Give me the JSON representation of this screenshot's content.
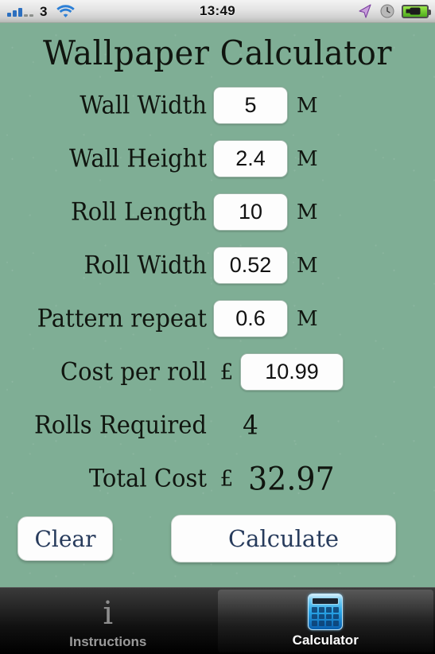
{
  "status_bar": {
    "signal_icon": "signal-bars-icon",
    "carrier": "3",
    "wifi_icon": "wifi-icon",
    "time": "13:49",
    "location_icon": "location-arrow-icon",
    "alarm_icon": "alarm-clock-icon",
    "battery_icon": "battery-charging-icon"
  },
  "app": {
    "title": "Wallpaper Calculator",
    "background_color": "#7fae95"
  },
  "form": {
    "rows": [
      {
        "label": "Wall Width",
        "value": "5",
        "unit": "M",
        "currency": ""
      },
      {
        "label": "Wall Height",
        "value": "2.4",
        "unit": "M",
        "currency": ""
      },
      {
        "label": "Roll Length",
        "value": "10",
        "unit": "M",
        "currency": ""
      },
      {
        "label": "Roll Width",
        "value": "0.52",
        "unit": "M",
        "currency": ""
      },
      {
        "label": "Pattern repeat",
        "value": "0.6",
        "unit": "M",
        "currency": ""
      },
      {
        "label": "Cost per roll",
        "value": "10.99",
        "unit": "",
        "currency": "£"
      }
    ]
  },
  "results": {
    "rolls": {
      "label": "Rolls Required",
      "value": "4",
      "currency": ""
    },
    "total": {
      "label": "Total Cost",
      "value": "32.97",
      "currency": "£"
    }
  },
  "buttons": {
    "clear": "Clear",
    "calculate": "Calculate",
    "text_color": "#273b5c"
  },
  "tab_bar": {
    "tabs": [
      {
        "label": "Instructions",
        "icon": "info-i-icon",
        "active": false
      },
      {
        "label": "Calculator",
        "icon": "calculator-icon",
        "active": true
      }
    ]
  }
}
